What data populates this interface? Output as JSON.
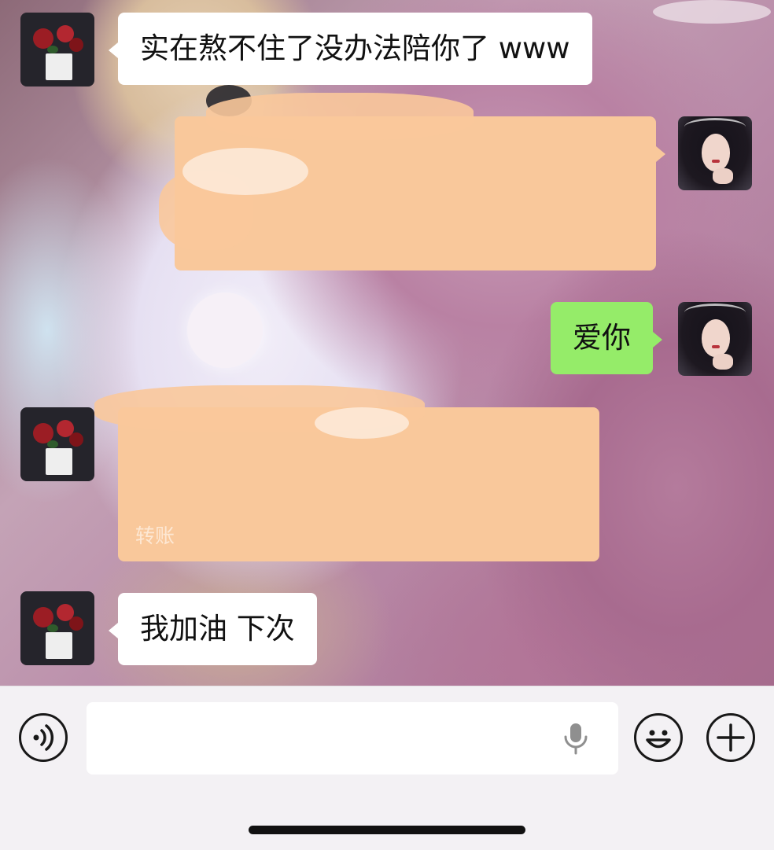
{
  "messages": [
    {
      "side": "in",
      "text": "实在熬不住了没办法陪你了 www"
    },
    {
      "side": "out",
      "text": "",
      "redacted": true,
      "color": "#f9c89b"
    },
    {
      "side": "out",
      "text": "爱你"
    },
    {
      "side": "in",
      "text": "转账",
      "redacted": true,
      "type": "transfer",
      "color": "#f9c89b"
    },
    {
      "side": "in",
      "text": "我加油 下次"
    }
  ],
  "input_bar": {
    "placeholder": "",
    "value": "",
    "icons": [
      "voice-icon",
      "microphone-icon",
      "emoji-icon",
      "plus-icon"
    ]
  },
  "colors": {
    "incoming_bubble": "#ffffff",
    "outgoing_bubble": "#95ec69",
    "redaction": "#f9c89b",
    "input_bar_bg": "#f3f1f4"
  }
}
